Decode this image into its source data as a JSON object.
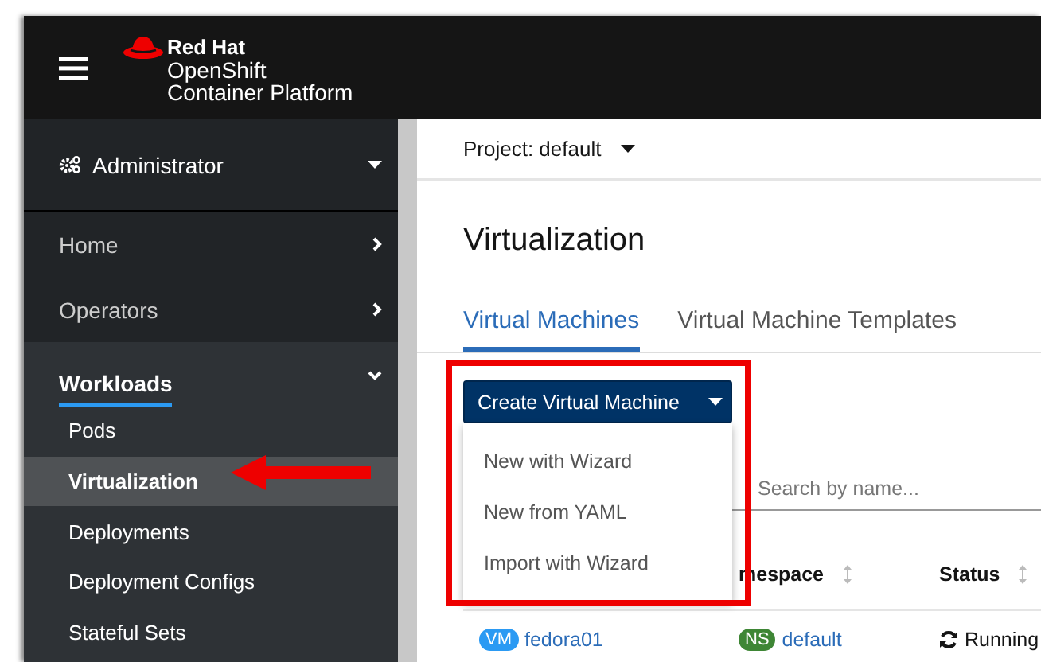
{
  "brand": {
    "line_1": "Red Hat",
    "line_2": "OpenShift",
    "line_3": "Container Platform"
  },
  "perspective": {
    "label": "Administrator"
  },
  "nav": [
    {
      "label": "Home",
      "expanded": false
    },
    {
      "label": "Operators",
      "expanded": false
    },
    {
      "label": "Workloads",
      "expanded": true,
      "children": [
        {
          "label": "Pods",
          "selected": false
        },
        {
          "label": "Virtualization",
          "selected": true
        },
        {
          "label": "Deployments",
          "selected": false
        },
        {
          "label": "Deployment Configs",
          "selected": false
        },
        {
          "label": "Stateful Sets",
          "selected": false
        }
      ]
    }
  ],
  "project": {
    "label": "Project: default"
  },
  "title": "Virtualization",
  "tabs": [
    {
      "label": "Virtual Machines",
      "selected": true
    },
    {
      "label": "Virtual Machine Templates",
      "selected": false
    }
  ],
  "create_button": {
    "label": "Create Virtual Machine",
    "expanded": true
  },
  "menu": [
    "New with Wizard",
    "New from YAML",
    "Import with Wizard"
  ],
  "search": {
    "placeholder": "Search by name..."
  },
  "table": {
    "columns": [
      "mespace",
      "Status"
    ],
    "rows": [
      {
        "name_badge": "VM",
        "name": "fedora01",
        "namespace_badge": "NS",
        "namespace": "default",
        "status": "Running"
      }
    ]
  }
}
